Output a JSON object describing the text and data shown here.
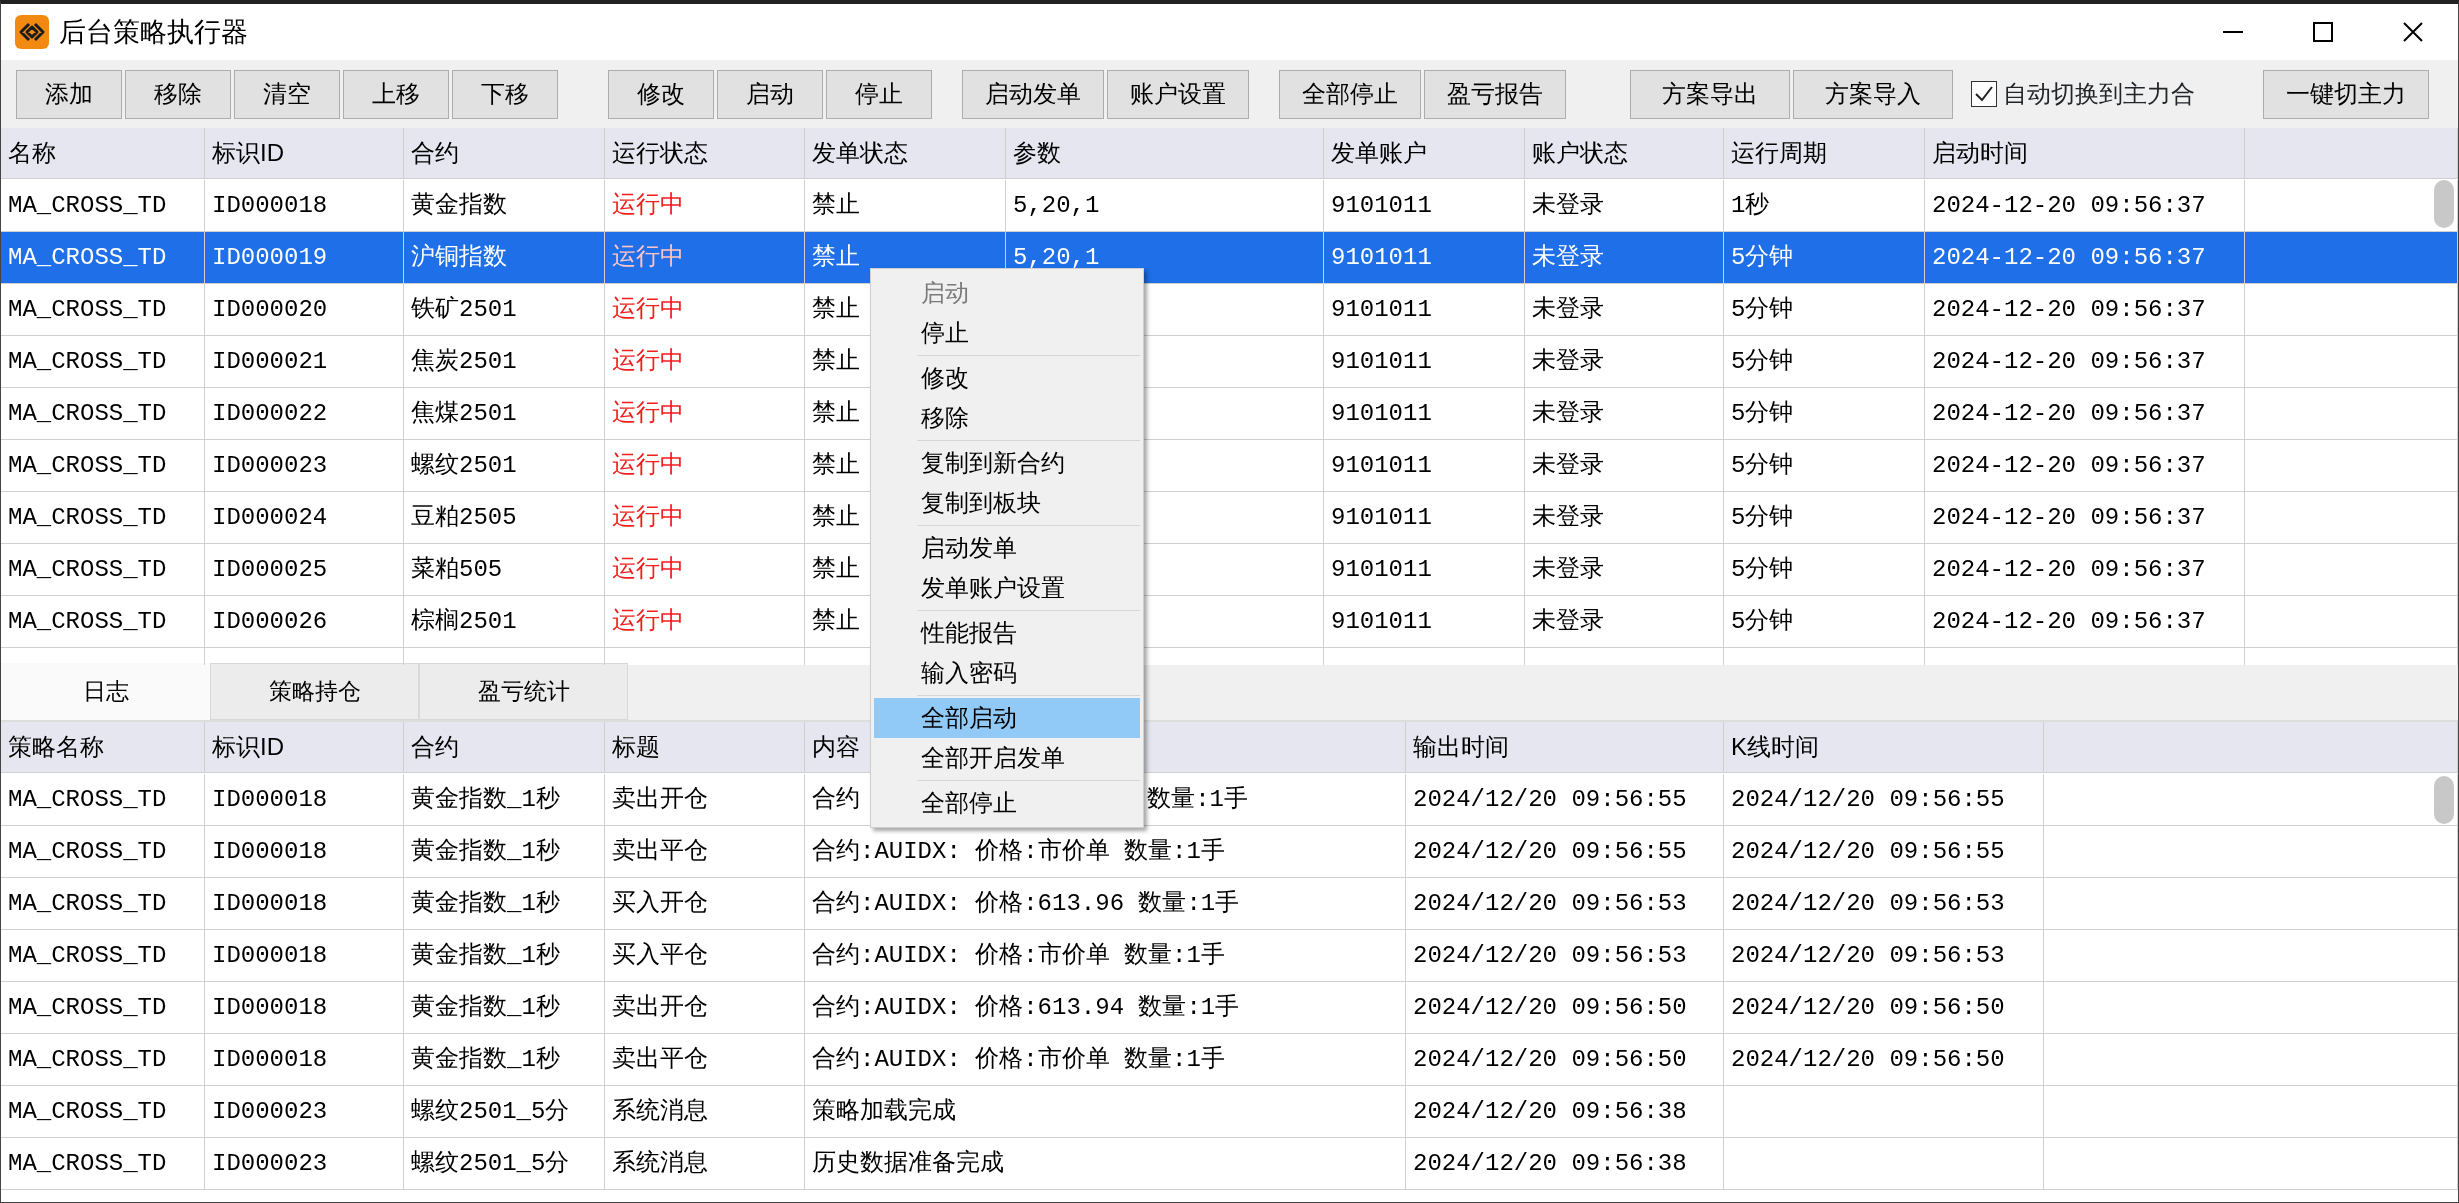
{
  "window": {
    "title": "后台策略执行器"
  },
  "toolbar": {
    "groups": [
      [
        "添加",
        "移除",
        "清空",
        "上移",
        "下移"
      ],
      [
        "修改",
        "启动",
        "停止"
      ],
      [
        "启动发单",
        "账户设置"
      ],
      [
        "全部停止",
        "盈亏报告"
      ],
      [
        "方案导出",
        "方案导入"
      ]
    ],
    "checkbox": {
      "label": "自动切换到主力合",
      "checked": true
    },
    "last_button": "一键切主力"
  },
  "strategy_table": {
    "columns": [
      "名称",
      "标识ID",
      "合约",
      "运行状态",
      "发单状态",
      "参数",
      "发单账户",
      "账户状态",
      "运行周期",
      "启动时间"
    ],
    "rows": [
      {
        "selected": false,
        "name": "MA_CROSS_TD",
        "id": "ID000018",
        "contract": "黄金指数",
        "run_status": "运行中",
        "order_status": "禁止",
        "params": "5,20,1",
        "account": "9101011",
        "account_status": "未登录",
        "period": "1秒",
        "start_time": "2024-12-20 09:56:37"
      },
      {
        "selected": true,
        "name": "MA_CROSS_TD",
        "id": "ID000019",
        "contract": "沪铜指数",
        "run_status": "运行中",
        "order_status": "禁止",
        "params": "5,20,1",
        "account": "9101011",
        "account_status": "未登录",
        "period": "5分钟",
        "start_time": "2024-12-20 09:56:37"
      },
      {
        "selected": false,
        "name": "MA_CROSS_TD",
        "id": "ID000020",
        "contract": "铁矿2501",
        "run_status": "运行中",
        "order_status": "禁止",
        "account": "9101011",
        "account_status": "未登录",
        "period": "5分钟",
        "start_time": "2024-12-20 09:56:37"
      },
      {
        "selected": false,
        "name": "MA_CROSS_TD",
        "id": "ID000021",
        "contract": "焦炭2501",
        "run_status": "运行中",
        "order_status": "禁止",
        "account": "9101011",
        "account_status": "未登录",
        "period": "5分钟",
        "start_time": "2024-12-20 09:56:37"
      },
      {
        "selected": false,
        "name": "MA_CROSS_TD",
        "id": "ID000022",
        "contract": "焦煤2501",
        "run_status": "运行中",
        "order_status": "禁止",
        "account": "9101011",
        "account_status": "未登录",
        "period": "5分钟",
        "start_time": "2024-12-20 09:56:37"
      },
      {
        "selected": false,
        "name": "MA_CROSS_TD",
        "id": "ID000023",
        "contract": "螺纹2501",
        "run_status": "运行中",
        "order_status": "禁止",
        "account": "9101011",
        "account_status": "未登录",
        "period": "5分钟",
        "start_time": "2024-12-20 09:56:37"
      },
      {
        "selected": false,
        "name": "MA_CROSS_TD",
        "id": "ID000024",
        "contract": "豆粕2505",
        "run_status": "运行中",
        "order_status": "禁止",
        "account": "9101011",
        "account_status": "未登录",
        "period": "5分钟",
        "start_time": "2024-12-20 09:56:37"
      },
      {
        "selected": false,
        "name": "MA_CROSS_TD",
        "id": "ID000025",
        "contract": "菜粕505",
        "run_status": "运行中",
        "order_status": "禁止",
        "account": "9101011",
        "account_status": "未登录",
        "period": "5分钟",
        "start_time": "2024-12-20 09:56:37"
      },
      {
        "selected": false,
        "name": "MA_CROSS_TD",
        "id": "ID000026",
        "contract": "棕榈2501",
        "run_status": "运行中",
        "order_status": "禁止",
        "account": "9101011",
        "account_status": "未登录",
        "period": "5分钟",
        "start_time": "2024-12-20 09:56:37"
      }
    ]
  },
  "tabs": [
    {
      "label": "日志",
      "selected": true
    },
    {
      "label": "策略持仓",
      "selected": false
    },
    {
      "label": "盈亏统计",
      "selected": false
    }
  ],
  "log_table": {
    "columns": [
      "策略名称",
      "标识ID",
      "合约",
      "标题",
      "内容",
      "输出时间",
      "K线时间"
    ],
    "rows": [
      {
        "strategy": "MA_CROSS_TD",
        "id": "ID000018",
        "contract": "黄金指数_1秒",
        "title": "卖出开仓",
        "content": "合约",
        "content_tail": "数量:1手",
        "output_time": "2024/12/20 09:56:55",
        "kline_time": "2024/12/20 09:56:55"
      },
      {
        "strategy": "MA_CROSS_TD",
        "id": "ID000018",
        "contract": "黄金指数_1秒",
        "title": "卖出平仓",
        "content": "合约:AUIDX: 价格:市价单 数量:1手",
        "output_time": "2024/12/20 09:56:55",
        "kline_time": "2024/12/20 09:56:55"
      },
      {
        "strategy": "MA_CROSS_TD",
        "id": "ID000018",
        "contract": "黄金指数_1秒",
        "title": "买入开仓",
        "content": "合约:AUIDX: 价格:613.96 数量:1手",
        "output_time": "2024/12/20 09:56:53",
        "kline_time": "2024/12/20 09:56:53"
      },
      {
        "strategy": "MA_CROSS_TD",
        "id": "ID000018",
        "contract": "黄金指数_1秒",
        "title": "买入平仓",
        "content": "合约:AUIDX: 价格:市价单 数量:1手",
        "output_time": "2024/12/20 09:56:53",
        "kline_time": "2024/12/20 09:56:53"
      },
      {
        "strategy": "MA_CROSS_TD",
        "id": "ID000018",
        "contract": "黄金指数_1秒",
        "title": "卖出开仓",
        "content": "合约:AUIDX: 价格:613.94 数量:1手",
        "output_time": "2024/12/20 09:56:50",
        "kline_time": "2024/12/20 09:56:50"
      },
      {
        "strategy": "MA_CROSS_TD",
        "id": "ID000018",
        "contract": "黄金指数_1秒",
        "title": "卖出平仓",
        "content": "合约:AUIDX: 价格:市价单 数量:1手",
        "output_time": "2024/12/20 09:56:50",
        "kline_time": "2024/12/20 09:56:50"
      },
      {
        "strategy": "MA_CROSS_TD",
        "id": "ID000023",
        "contract": "螺纹2501_5分",
        "title": "系统消息",
        "content": "策略加载完成",
        "output_time": "2024/12/20 09:56:38"
      },
      {
        "strategy": "MA_CROSS_TD",
        "id": "ID000023",
        "contract": "螺纹2501_5分",
        "title": "系统消息",
        "content": "历史数据准备完成",
        "output_time": "2024/12/20 09:56:38"
      }
    ]
  },
  "context_menu": {
    "groups": [
      [
        {
          "label": "启动",
          "disabled": true,
          "selected": false
        },
        {
          "label": "停止",
          "disabled": false,
          "selected": false
        }
      ],
      [
        {
          "label": "修改",
          "disabled": false,
          "selected": false
        },
        {
          "label": "移除",
          "disabled": false,
          "selected": false
        }
      ],
      [
        {
          "label": "复制到新合约",
          "disabled": false,
          "selected": false
        },
        {
          "label": "复制到板块",
          "disabled": false,
          "selected": false
        }
      ],
      [
        {
          "label": "启动发单",
          "disabled": false,
          "selected": false
        },
        {
          "label": "发单账户设置",
          "disabled": false,
          "selected": false
        }
      ],
      [
        {
          "label": "性能报告",
          "disabled": false,
          "selected": false
        },
        {
          "label": "输入密码",
          "disabled": false,
          "selected": false
        }
      ],
      [
        {
          "label": "全部启动",
          "disabled": false,
          "selected": true
        },
        {
          "label": "全部开启发单",
          "disabled": false,
          "selected": false
        }
      ],
      [
        {
          "label": "全部停止",
          "disabled": false,
          "selected": false
        }
      ]
    ]
  }
}
